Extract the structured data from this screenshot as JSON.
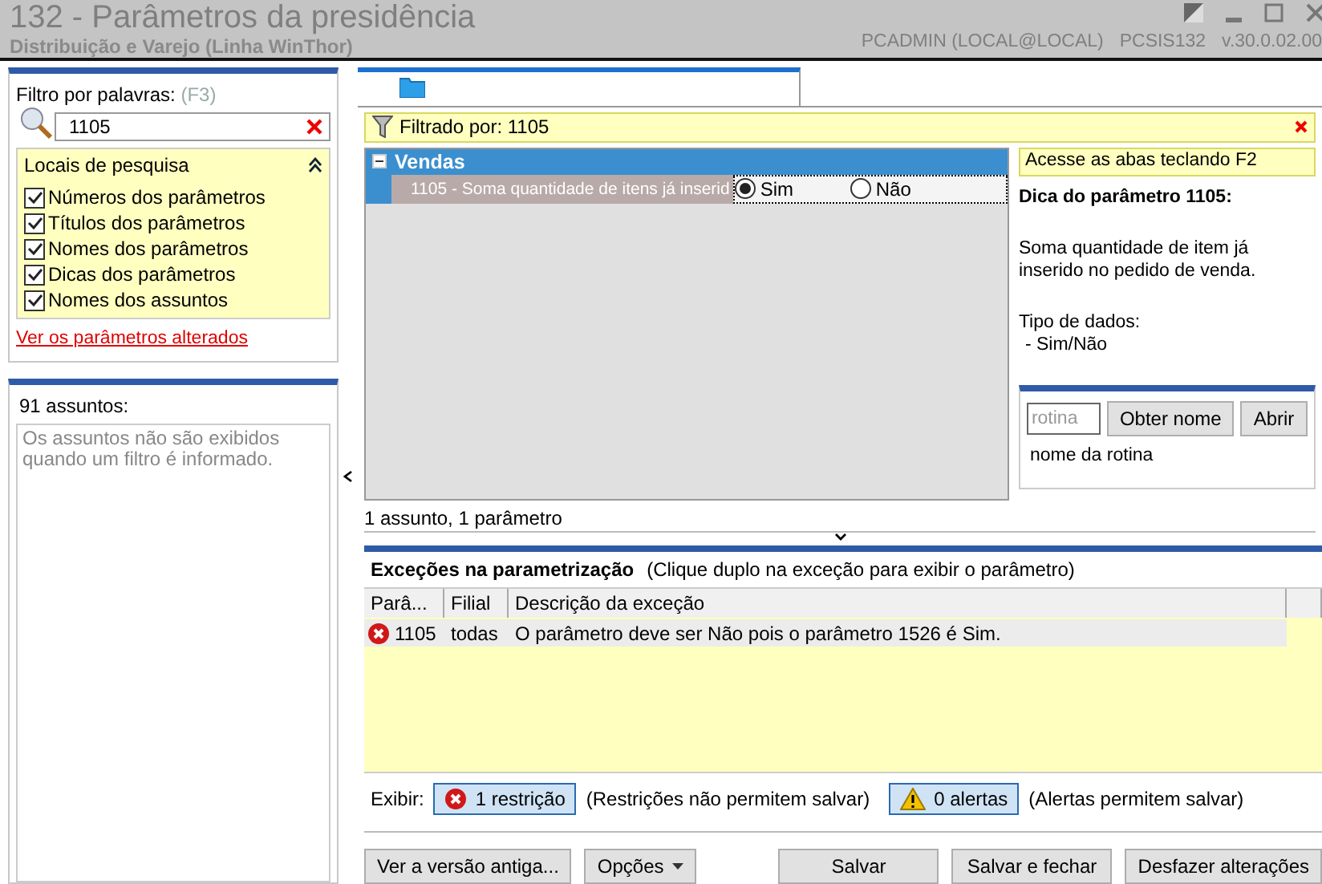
{
  "window": {
    "title": "132 - Parâmetros da presidência",
    "subtitle": "Distribuição e Varejo (Linha WinThor)",
    "user": "PCADMIN (LOCAL@LOCAL)",
    "program": "PCSIS132",
    "version": "v.30.0.02.00"
  },
  "filter": {
    "label": "Filtro por palavras:",
    "shortcut": "(F3)",
    "value": "1105"
  },
  "search_locations": {
    "title": "Locais de pesquisa",
    "expanded": true,
    "options": [
      {
        "label": "Números dos parâmetros",
        "checked": true
      },
      {
        "label": "Títulos dos parâmetros",
        "checked": true
      },
      {
        "label": "Nomes dos parâmetros",
        "checked": true
      },
      {
        "label": "Dicas dos parâmetros",
        "checked": true
      },
      {
        "label": "Nomes dos assuntos",
        "checked": true
      }
    ]
  },
  "changed_link": "Ver os parâmetros alterados",
  "subjects": {
    "count_label": "91 assuntos:",
    "message": "Os assuntos não são exibidos quando um filtro é informado."
  },
  "filtered_by": "Filtrado por: 1105",
  "tree": [
    {
      "label": "Vendas",
      "expanded": true,
      "children": [
        {
          "label": "1105 - Soma quantidade de itens já inserid",
          "selected": true,
          "options": [
            {
              "label": "Sim",
              "selected": true
            },
            {
              "label": "Não",
              "selected": false
            }
          ]
        }
      ]
    }
  ],
  "tree_status": "1 assunto, 1 parâmetro",
  "hint": {
    "banner": "Acesse as abas teclando F2",
    "title": "Dica do parâmetro 1105:",
    "text": "Soma quantidade de item já inserido no pedido de venda.",
    "type_label": "Tipo de dados:",
    "type_value": "- Sim/Não"
  },
  "routine": {
    "placeholder": "rotina",
    "buttons": [
      "Obter nome",
      "Abrir"
    ],
    "name": "nome da rotina"
  },
  "exceptions": {
    "title": "Exceções na parametrização",
    "note": "(Clique duplo na exceção para exibir o parâmetro)",
    "columns": [
      "Parâ...",
      "Filial",
      "Descrição da exceção"
    ],
    "rows": [
      {
        "kind": "error",
        "cells": [
          "1105",
          "todas",
          "O parâmetro deve ser Não pois o parâmetro 1526 é Sim."
        ]
      }
    ],
    "show_label": "Exibir:",
    "toggles": [
      {
        "kind": "error",
        "label": "1 restrição",
        "note": "(Restrições não permitem salvar)",
        "selected": true
      },
      {
        "kind": "warning",
        "label": "0 alertas",
        "note": "(Alertas permitem salvar)",
        "selected": true
      }
    ]
  },
  "buttons": [
    {
      "kind": "plain",
      "label": "Ver a versão antiga..."
    },
    {
      "kind": "menu",
      "label": "Opções"
    },
    {
      "kind": "plain",
      "label": "Salvar"
    },
    {
      "kind": "plain",
      "label": "Salvar e fechar"
    },
    {
      "kind": "plain",
      "label": "Desfazer alterações"
    }
  ]
}
